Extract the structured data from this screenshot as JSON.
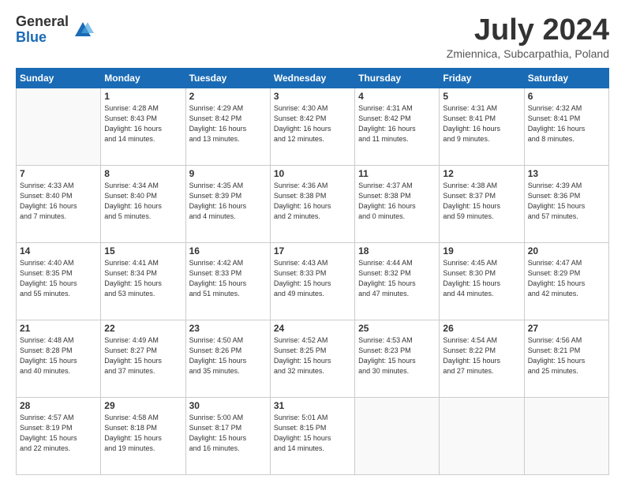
{
  "header": {
    "logo_general": "General",
    "logo_blue": "Blue",
    "month_title": "July 2024",
    "location": "Zmiennica, Subcarpathia, Poland"
  },
  "weekdays": [
    "Sunday",
    "Monday",
    "Tuesday",
    "Wednesday",
    "Thursday",
    "Friday",
    "Saturday"
  ],
  "weeks": [
    [
      {
        "day": "",
        "info": ""
      },
      {
        "day": "1",
        "info": "Sunrise: 4:28 AM\nSunset: 8:43 PM\nDaylight: 16 hours\nand 14 minutes."
      },
      {
        "day": "2",
        "info": "Sunrise: 4:29 AM\nSunset: 8:42 PM\nDaylight: 16 hours\nand 13 minutes."
      },
      {
        "day": "3",
        "info": "Sunrise: 4:30 AM\nSunset: 8:42 PM\nDaylight: 16 hours\nand 12 minutes."
      },
      {
        "day": "4",
        "info": "Sunrise: 4:31 AM\nSunset: 8:42 PM\nDaylight: 16 hours\nand 11 minutes."
      },
      {
        "day": "5",
        "info": "Sunrise: 4:31 AM\nSunset: 8:41 PM\nDaylight: 16 hours\nand 9 minutes."
      },
      {
        "day": "6",
        "info": "Sunrise: 4:32 AM\nSunset: 8:41 PM\nDaylight: 16 hours\nand 8 minutes."
      }
    ],
    [
      {
        "day": "7",
        "info": "Sunrise: 4:33 AM\nSunset: 8:40 PM\nDaylight: 16 hours\nand 7 minutes."
      },
      {
        "day": "8",
        "info": "Sunrise: 4:34 AM\nSunset: 8:40 PM\nDaylight: 16 hours\nand 5 minutes."
      },
      {
        "day": "9",
        "info": "Sunrise: 4:35 AM\nSunset: 8:39 PM\nDaylight: 16 hours\nand 4 minutes."
      },
      {
        "day": "10",
        "info": "Sunrise: 4:36 AM\nSunset: 8:38 PM\nDaylight: 16 hours\nand 2 minutes."
      },
      {
        "day": "11",
        "info": "Sunrise: 4:37 AM\nSunset: 8:38 PM\nDaylight: 16 hours\nand 0 minutes."
      },
      {
        "day": "12",
        "info": "Sunrise: 4:38 AM\nSunset: 8:37 PM\nDaylight: 15 hours\nand 59 minutes."
      },
      {
        "day": "13",
        "info": "Sunrise: 4:39 AM\nSunset: 8:36 PM\nDaylight: 15 hours\nand 57 minutes."
      }
    ],
    [
      {
        "day": "14",
        "info": "Sunrise: 4:40 AM\nSunset: 8:35 PM\nDaylight: 15 hours\nand 55 minutes."
      },
      {
        "day": "15",
        "info": "Sunrise: 4:41 AM\nSunset: 8:34 PM\nDaylight: 15 hours\nand 53 minutes."
      },
      {
        "day": "16",
        "info": "Sunrise: 4:42 AM\nSunset: 8:33 PM\nDaylight: 15 hours\nand 51 minutes."
      },
      {
        "day": "17",
        "info": "Sunrise: 4:43 AM\nSunset: 8:33 PM\nDaylight: 15 hours\nand 49 minutes."
      },
      {
        "day": "18",
        "info": "Sunrise: 4:44 AM\nSunset: 8:32 PM\nDaylight: 15 hours\nand 47 minutes."
      },
      {
        "day": "19",
        "info": "Sunrise: 4:45 AM\nSunset: 8:30 PM\nDaylight: 15 hours\nand 44 minutes."
      },
      {
        "day": "20",
        "info": "Sunrise: 4:47 AM\nSunset: 8:29 PM\nDaylight: 15 hours\nand 42 minutes."
      }
    ],
    [
      {
        "day": "21",
        "info": "Sunrise: 4:48 AM\nSunset: 8:28 PM\nDaylight: 15 hours\nand 40 minutes."
      },
      {
        "day": "22",
        "info": "Sunrise: 4:49 AM\nSunset: 8:27 PM\nDaylight: 15 hours\nand 37 minutes."
      },
      {
        "day": "23",
        "info": "Sunrise: 4:50 AM\nSunset: 8:26 PM\nDaylight: 15 hours\nand 35 minutes."
      },
      {
        "day": "24",
        "info": "Sunrise: 4:52 AM\nSunset: 8:25 PM\nDaylight: 15 hours\nand 32 minutes."
      },
      {
        "day": "25",
        "info": "Sunrise: 4:53 AM\nSunset: 8:23 PM\nDaylight: 15 hours\nand 30 minutes."
      },
      {
        "day": "26",
        "info": "Sunrise: 4:54 AM\nSunset: 8:22 PM\nDaylight: 15 hours\nand 27 minutes."
      },
      {
        "day": "27",
        "info": "Sunrise: 4:56 AM\nSunset: 8:21 PM\nDaylight: 15 hours\nand 25 minutes."
      }
    ],
    [
      {
        "day": "28",
        "info": "Sunrise: 4:57 AM\nSunset: 8:19 PM\nDaylight: 15 hours\nand 22 minutes."
      },
      {
        "day": "29",
        "info": "Sunrise: 4:58 AM\nSunset: 8:18 PM\nDaylight: 15 hours\nand 19 minutes."
      },
      {
        "day": "30",
        "info": "Sunrise: 5:00 AM\nSunset: 8:17 PM\nDaylight: 15 hours\nand 16 minutes."
      },
      {
        "day": "31",
        "info": "Sunrise: 5:01 AM\nSunset: 8:15 PM\nDaylight: 15 hours\nand 14 minutes."
      },
      {
        "day": "",
        "info": ""
      },
      {
        "day": "",
        "info": ""
      },
      {
        "day": "",
        "info": ""
      }
    ]
  ]
}
